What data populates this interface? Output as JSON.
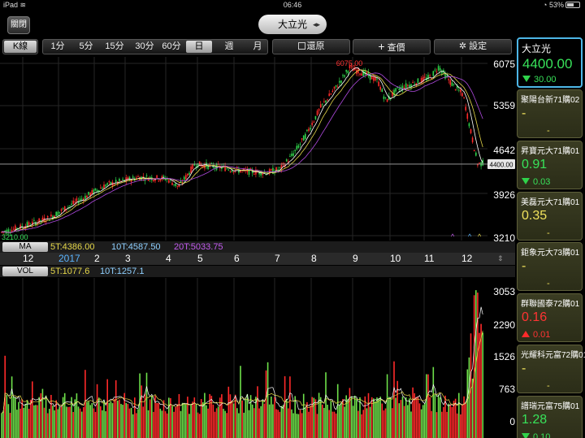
{
  "status": {
    "device": "iPad",
    "time": "06:46",
    "battery": "53%"
  },
  "nav": {
    "close_label": "關閉",
    "stock_name": "大立光"
  },
  "toolbar": {
    "period_tab": "K線",
    "periods": [
      "1分",
      "5分",
      "15分",
      "30分",
      "60分",
      "日",
      "週",
      "月"
    ],
    "selected_period": "日",
    "restore_label": "還原",
    "query_label": "查價",
    "settings_label": "設定"
  },
  "price_axis": [
    "6075",
    "5359",
    "4642",
    "3926",
    "3210"
  ],
  "annotations": {
    "high": "6075.00",
    "low": "3210.00",
    "last_tag": "4400.00"
  },
  "ma_strip": {
    "tag": "MA",
    "ma5": "5T:4386.00",
    "ma10": "10T:4587.50",
    "ma20": "20T:5033.75"
  },
  "month_labels": [
    "12",
    "2017",
    "2",
    "3",
    "4",
    "5",
    "6",
    "7",
    "8",
    "9",
    "10",
    "11",
    "12"
  ],
  "vol_strip": {
    "tag": "VOL",
    "v5": "5T:1077.6",
    "v10": "10T:1257.1"
  },
  "vol_axis": [
    "3053",
    "2290",
    "1526",
    "763",
    "0"
  ],
  "colors": {
    "up": "#ff2a2a",
    "down": "#2fd24a",
    "ma5": "#ffffff",
    "ma10": "#e6d84a",
    "ma20": "#b04ae0",
    "accent": "#4db6e6"
  },
  "watchlist": [
    {
      "name": "大立光",
      "price": "4400.00",
      "change": "30.00",
      "direction": "down",
      "style": "green"
    },
    {
      "name": "聚陽台新71購02",
      "price": "-",
      "change": "-",
      "direction": "none",
      "style": "yellow"
    },
    {
      "name": "昇寶元大71購01",
      "price": "0.91",
      "change": "0.03",
      "direction": "down",
      "style": "green"
    },
    {
      "name": "美磊元大71購01",
      "price": "0.35",
      "change": "-",
      "direction": "none",
      "style": "yellow"
    },
    {
      "name": "鉅象元大73購01",
      "price": "-",
      "change": "-",
      "direction": "none",
      "style": "yellow"
    },
    {
      "name": "群聯國泰72購01",
      "price": "0.16",
      "change": "0.01",
      "direction": "up",
      "style": "red"
    },
    {
      "name": "光耀科元富72購01",
      "price": "-",
      "change": "-",
      "direction": "none",
      "style": "yellow"
    },
    {
      "name": "譜瑞元富75購01",
      "price": "1.28",
      "change": "0.10",
      "direction": "down",
      "style": "green"
    }
  ]
}
